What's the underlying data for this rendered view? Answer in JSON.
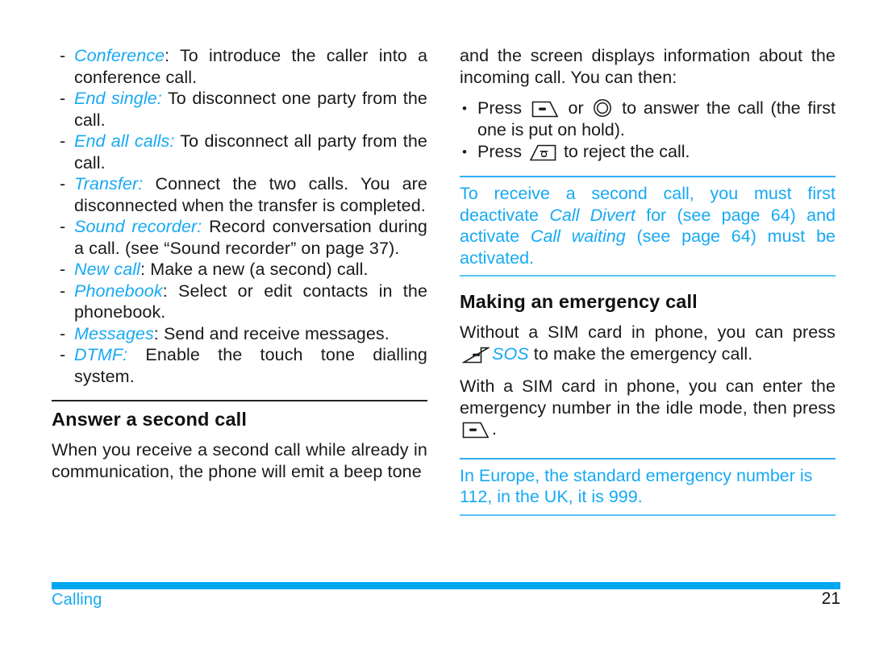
{
  "footer": {
    "section": "Calling",
    "page_number": "21"
  },
  "colors": {
    "accent_blue": "#17A9F3",
    "footer_bar": "#00A8F0",
    "rule_dark": "#222222"
  },
  "left_column": {
    "options_list": [
      {
        "term": "Conference",
        "separator": ":",
        "text": " To introduce the caller into a conference call."
      },
      {
        "term": "End single:",
        "separator": "",
        "text": " To disconnect one party from the call."
      },
      {
        "term": "End all calls:",
        "separator": "",
        "text": " To disconnect all party from the call."
      },
      {
        "term": "Transfer:",
        "separator": "",
        "text": " Connect the two calls. You are disconnected when the transfer is completed."
      },
      {
        "term": "Sound recorder:",
        "separator": "",
        "text": " Record conversation during a call. (see “Sound recorder” on page 37)."
      },
      {
        "term": "New call",
        "separator": ":",
        "text": " Make a new (a second) call."
      },
      {
        "term": "Phonebook",
        "separator": ":",
        "text": " Select or edit contacts in the phonebook."
      },
      {
        "term": "Messages",
        "separator": ":",
        "text": " Send and receive messages."
      },
      {
        "term": "DTMF:",
        "separator": "",
        "text": " Enable the touch tone dialling system."
      }
    ],
    "heading": "Answer a second call",
    "body": "When you receive a second call while already in communication, the phone will emit a beep tone"
  },
  "right_column": {
    "intro": "and the screen displays information about the incoming call. You can then:",
    "answer_bullet": {
      "press_label": "Press",
      "or_label": "or",
      "tail": "to answer the call (the first one is put on hold).",
      "key_call_icon": "call-key-icon",
      "key_ok_icon": "ok-key-icon"
    },
    "reject_bullet": {
      "press_label": "Press",
      "tail": "to reject the call.",
      "key_hangup_icon": "hangup-key-icon"
    },
    "note_call_waiting": {
      "part1": "To receive a second call, you must first deactivate ",
      "term1": "Call Divert",
      "part2": " for (see page 64) and activate ",
      "term2": "Call waiting",
      "part3": " (see page 64) must be activated."
    },
    "heading": "Making an emergency call",
    "sos_paragraph": {
      "part1": "Without a SIM card in phone, you can press ",
      "key_icon": "sos-key-icon",
      "sos_label": "SOS",
      "part2": " to make the emergency call."
    },
    "sim_paragraph": {
      "part1": "With a SIM card in phone, you can enter the emergency number in the idle mode, then press ",
      "key_icon": "call-key-icon",
      "part2": "."
    },
    "note_emergency": "In Europe, the standard emergency number is 112, in the UK, it is 999."
  }
}
